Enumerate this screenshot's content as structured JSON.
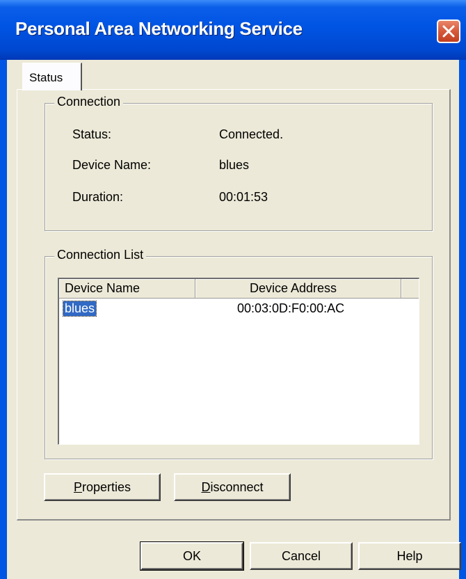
{
  "window": {
    "title": "Personal Area Networking Service"
  },
  "tabs": [
    {
      "label": "Status",
      "selected": true
    }
  ],
  "connection": {
    "legend": "Connection",
    "status_label": "Status:",
    "status_value": "Connected.",
    "device_name_label": "Device Name:",
    "device_name_value": "blues",
    "duration_label": "Duration:",
    "duration_value": "00:01:53"
  },
  "connection_list": {
    "legend": "Connection List",
    "columns": [
      "Device Name",
      "Device Address"
    ],
    "rows": [
      {
        "device_name": "blues",
        "device_address": "00:03:0D:F0:00:AC",
        "selected": true
      }
    ]
  },
  "buttons": {
    "properties_mnemonic": "P",
    "properties_rest": "roperties",
    "disconnect_mnemonic": "D",
    "disconnect_rest": "isconnect",
    "ok": "OK",
    "cancel": "Cancel",
    "help": "Help"
  },
  "colors": {
    "titlebar": "#0054e3",
    "close_button": "#d65a3b",
    "dialog_face": "#ece9d8",
    "selection": "#316ac5"
  },
  "icons": {
    "close": "close-icon"
  }
}
